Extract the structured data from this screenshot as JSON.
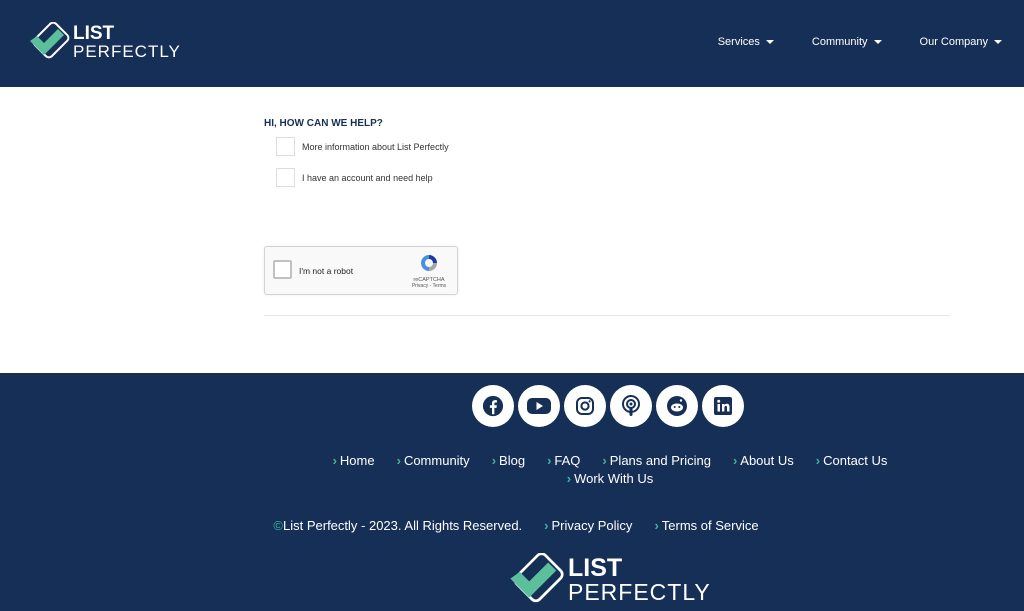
{
  "header": {
    "logo": {
      "line1": "LIST",
      "line2": "PERFECTLY"
    },
    "nav": [
      {
        "label": "Services"
      },
      {
        "label": "Community"
      },
      {
        "label": "Our Company"
      }
    ]
  },
  "form": {
    "question": "HI, HOW CAN WE HELP?",
    "options": [
      {
        "label": "More information about List Perfectly",
        "checked": false
      },
      {
        "label": "I have an account and need help",
        "checked": false
      }
    ],
    "captcha": {
      "label": "I'm not a robot",
      "brand": "reCAPTCHA",
      "links": "Privacy - Terms"
    }
  },
  "footer": {
    "socials": [
      "facebook-icon",
      "youtube-icon",
      "instagram-icon",
      "podcast-icon",
      "reddit-icon",
      "linkedin-icon"
    ],
    "links": [
      {
        "label": "Home"
      },
      {
        "label": "Community"
      },
      {
        "label": "Blog"
      },
      {
        "label": "FAQ"
      },
      {
        "label": "Plans and Pricing"
      },
      {
        "label": "About Us"
      },
      {
        "label": "Contact Us"
      },
      {
        "label": "Work With Us"
      }
    ],
    "copyright_symbol": "©",
    "copyright": "List Perfectly - 2023. All Rights Reserved.",
    "legal": [
      {
        "label": "Privacy Policy"
      },
      {
        "label": "Terms of Service"
      }
    ],
    "logo": {
      "line1": "LIST",
      "line2": "PERFECTLY"
    }
  },
  "colors": {
    "navy": "#162f57",
    "accent": "#3cb6a0"
  }
}
